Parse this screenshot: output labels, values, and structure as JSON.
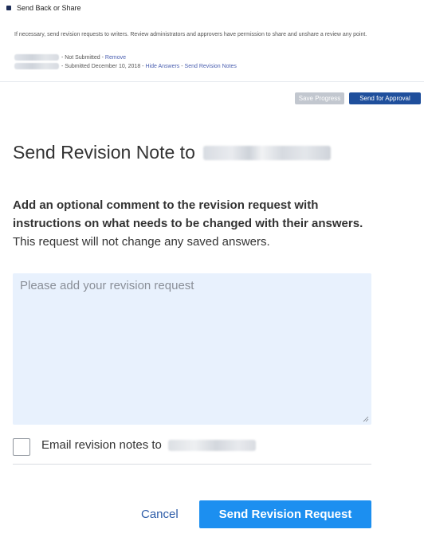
{
  "panel": {
    "title": "Send Back or Share",
    "description": "If necessary, send revision requests to writers. Review administrators and approvers have permission to share and unshare a review any point.",
    "writers": [
      {
        "status": "- Not Submitted -",
        "action": "Remove"
      },
      {
        "status": "- Submitted December 10, 2018 -",
        "action": "Hide Answers",
        "separator": " - ",
        "action2": "Send Revision Notes"
      }
    ]
  },
  "toolbar": {
    "save_label": "Save Progress",
    "approval_label": "Send for Approval"
  },
  "modal": {
    "title": "Send Revision Note to",
    "instructions_bold": "Add an optional comment to the revision request with instructions on what needs to be changed with their answers.",
    "instructions_normal": " This request will not change any saved answers.",
    "textarea_placeholder": "Please add your revision request",
    "email_label": "Email revision notes to",
    "email_checked": false,
    "cancel_label": "Cancel",
    "send_label": "Send Revision Request"
  },
  "colors": {
    "primary_button": "#1c8ff0",
    "approval_button": "#1f4f9c",
    "disabled_button": "#c2c7cf",
    "textarea_bg": "#e8f1fd",
    "link": "#2d5ca8"
  }
}
